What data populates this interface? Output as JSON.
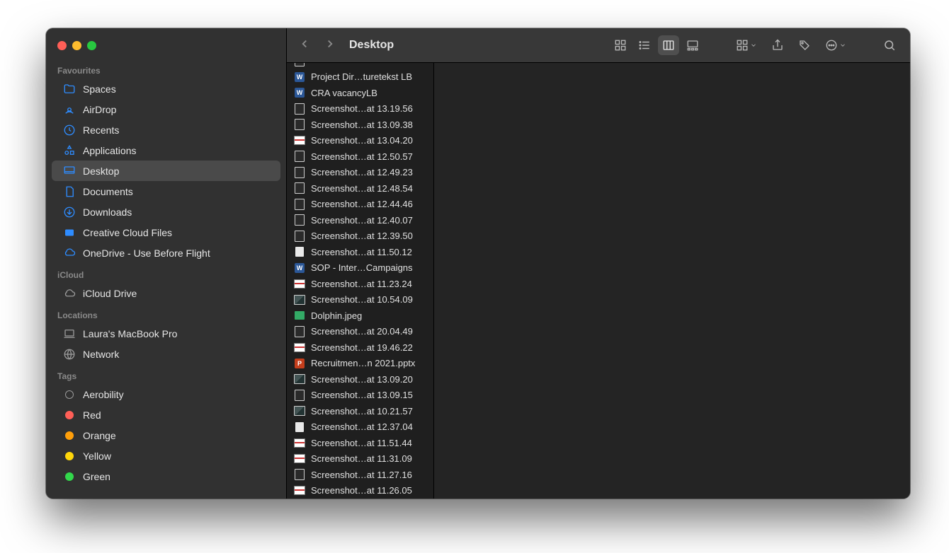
{
  "window_title": "Desktop",
  "traffic_lights": [
    "close",
    "minimize",
    "zoom"
  ],
  "sidebar": {
    "sections": [
      {
        "label": "Favourites",
        "items": [
          {
            "icon": "folder",
            "name": "spaces",
            "label": "Spaces"
          },
          {
            "icon": "airdrop",
            "name": "airdrop",
            "label": "AirDrop"
          },
          {
            "icon": "clock",
            "name": "recents",
            "label": "Recents"
          },
          {
            "icon": "apps",
            "name": "applications",
            "label": "Applications"
          },
          {
            "icon": "desktop",
            "name": "desktop",
            "label": "Desktop",
            "selected": true
          },
          {
            "icon": "doc",
            "name": "documents",
            "label": "Documents"
          },
          {
            "icon": "download",
            "name": "downloads",
            "label": "Downloads"
          },
          {
            "icon": "cc",
            "name": "creative-cloud",
            "label": "Creative Cloud Files"
          },
          {
            "icon": "cloud",
            "name": "onedrive",
            "label": "OneDrive - Use Before Flight"
          }
        ]
      },
      {
        "label": "iCloud",
        "items": [
          {
            "icon": "icloud",
            "name": "icloud-drive",
            "label": "iCloud Drive",
            "grey": true
          }
        ]
      },
      {
        "label": "Locations",
        "items": [
          {
            "icon": "laptop",
            "name": "this-mac",
            "label": "Laura's MacBook Pro",
            "grey": true
          },
          {
            "icon": "network",
            "name": "network",
            "label": "Network",
            "grey": true
          }
        ]
      },
      {
        "label": "Tags",
        "items": [
          {
            "tag": "#00000000",
            "outline": true,
            "name": "tag-aerobility",
            "label": "Aerobility"
          },
          {
            "tag": "#ff5f57",
            "name": "tag-red",
            "label": "Red"
          },
          {
            "tag": "#ff9f0a",
            "name": "tag-orange",
            "label": "Orange"
          },
          {
            "tag": "#ffd60a",
            "name": "tag-yellow",
            "label": "Yellow"
          },
          {
            "tag": "#32d74b",
            "name": "tag-green",
            "label": "Green"
          }
        ]
      }
    ]
  },
  "toolbar": {
    "back": "Back",
    "forward": "Forward",
    "views": {
      "icons": "Icons",
      "list": "List",
      "columns": "Columns",
      "gallery": "Gallery",
      "active": "columns"
    },
    "group": "Group",
    "share": "Share",
    "tags": "Edit Tags",
    "more": "More",
    "search": "Search"
  },
  "column_files": [
    {
      "icon": "word",
      "name": "Project Dir…turetekst LB"
    },
    {
      "icon": "word",
      "name": "CRA vacancyLB"
    },
    {
      "icon": "generic",
      "name": "Screenshot…at 13.19.56"
    },
    {
      "icon": "generic",
      "name": "Screenshot…at 13.09.38"
    },
    {
      "icon": "thumb",
      "name": "Screenshot…at 13.04.20"
    },
    {
      "icon": "generic",
      "name": "Screenshot…at 12.50.57"
    },
    {
      "icon": "generic",
      "name": "Screenshot…at 12.49.23"
    },
    {
      "icon": "generic",
      "name": "Screenshot…at 12.48.54"
    },
    {
      "icon": "generic",
      "name": "Screenshot…at 12.44.46"
    },
    {
      "icon": "generic",
      "name": "Screenshot…at 12.40.07"
    },
    {
      "icon": "generic",
      "name": "Screenshot…at 12.39.50"
    },
    {
      "icon": "doc",
      "name": "Screenshot…at 11.50.12"
    },
    {
      "icon": "word",
      "name": "SOP - Inter…Campaigns"
    },
    {
      "icon": "thumb",
      "name": "Screenshot…at 11.23.24"
    },
    {
      "icon": "image",
      "name": "Screenshot…at 10.54.09"
    },
    {
      "icon": "jpeg",
      "name": "Dolphin.jpeg"
    },
    {
      "icon": "generic",
      "name": "Screenshot…at 20.04.49"
    },
    {
      "icon": "thumb",
      "name": "Screenshot…at 19.46.22"
    },
    {
      "icon": "ppt",
      "name": "Recruitmen…n 2021.pptx"
    },
    {
      "icon": "image",
      "name": "Screenshot…at 13.09.20"
    },
    {
      "icon": "generic",
      "name": "Screenshot…at 13.09.15"
    },
    {
      "icon": "image",
      "name": "Screenshot…at 10.21.57"
    },
    {
      "icon": "doc",
      "name": "Screenshot…at 12.37.04"
    },
    {
      "icon": "thumb",
      "name": "Screenshot…at 11.51.44"
    },
    {
      "icon": "thumb",
      "name": "Screenshot…at 11.31.09"
    },
    {
      "icon": "generic",
      "name": "Screenshot…at 11.27.16"
    },
    {
      "icon": "thumb",
      "name": "Screenshot…at 11.26.05"
    }
  ]
}
